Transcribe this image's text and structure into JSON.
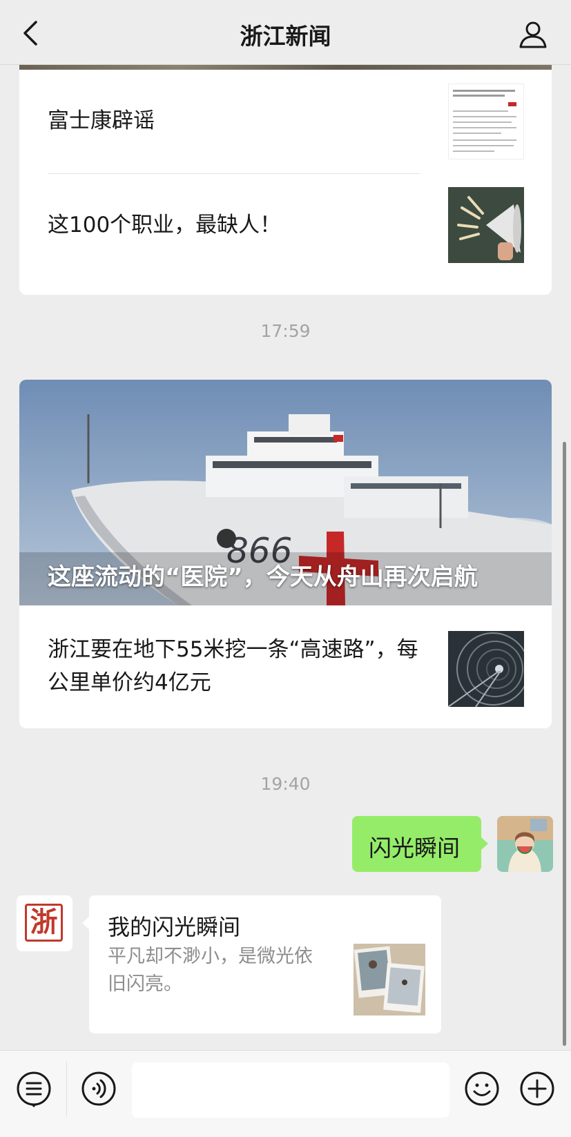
{
  "header": {
    "title": "浙江新闻",
    "back_icon": "chevron-left-icon",
    "profile_icon": "user-icon"
  },
  "card1": {
    "items": [
      {
        "title": "富士康辟谣",
        "thumb": "document-screenshot"
      },
      {
        "title": "这100个职业，最缺人！",
        "thumb": "megaphone"
      }
    ]
  },
  "timestamps": {
    "t1": "17:59",
    "t2": "19:40"
  },
  "card2": {
    "hero_title": "这座流动的“医院”，今天从舟山再次启航",
    "ship_number": "866",
    "item_title": "浙江要在地下55米挖一条“高速路”，每公里单价约4亿元",
    "item_thumb": "tunnel"
  },
  "chat": {
    "my_message": "闪光瞬间",
    "sender_avatar_glyph": "浙",
    "share": {
      "title": "我的闪光瞬间",
      "description": "平凡却不渺小，是微光依旧闪亮。"
    }
  },
  "input_bar": {
    "icons": [
      "menu-list-icon",
      "voice-icon",
      "emoji-icon",
      "plus-icon"
    ]
  },
  "colors": {
    "my_bubble": "#95ec69",
    "background": "#ededed",
    "brand_red": "#c0392b"
  }
}
